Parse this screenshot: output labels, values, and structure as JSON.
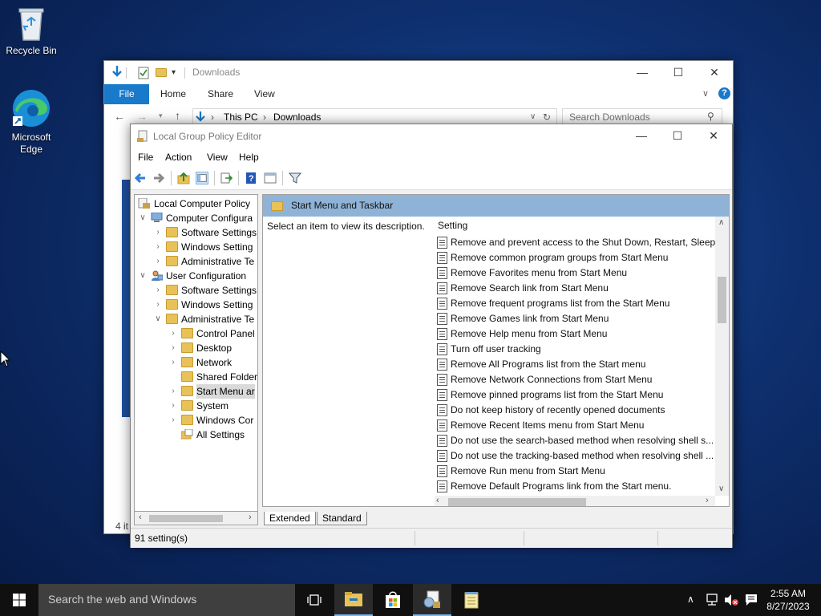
{
  "desktop": {
    "recycle_bin": "Recycle Bin",
    "edge_line1": "Microsoft",
    "edge_line2": "Edge"
  },
  "explorer": {
    "title": "Downloads",
    "ribbon_tabs": [
      "File",
      "Home",
      "Share",
      "View"
    ],
    "address_root": "This PC",
    "address_leaf": "Downloads",
    "search_placeholder": "Search Downloads",
    "status": "4 it"
  },
  "gpedit": {
    "title": "Local Group Policy Editor",
    "menu": [
      "File",
      "Action",
      "View",
      "Help"
    ],
    "tree": [
      {
        "label": "Local Computer Policy",
        "depth": 0,
        "icon": "computer-policy-icon"
      },
      {
        "label": "Computer Configura",
        "depth": 1,
        "icon": "computer-icon",
        "expander": "expanded"
      },
      {
        "label": "Software Settings",
        "depth": 2,
        "icon": "folder-icon",
        "expander": "collapsed"
      },
      {
        "label": "Windows Setting",
        "depth": 2,
        "icon": "folder-icon",
        "expander": "collapsed"
      },
      {
        "label": "Administrative Te",
        "depth": 2,
        "icon": "folder-icon",
        "expander": "collapsed"
      },
      {
        "label": "User Configuration",
        "depth": 1,
        "icon": "user-icon",
        "expander": "expanded"
      },
      {
        "label": "Software Settings",
        "depth": 2,
        "icon": "folder-icon",
        "expander": "collapsed"
      },
      {
        "label": "Windows Setting",
        "depth": 2,
        "icon": "folder-icon",
        "expander": "collapsed"
      },
      {
        "label": "Administrative Te",
        "depth": 2,
        "icon": "folder-icon",
        "expander": "expanded"
      },
      {
        "label": "Control Panel",
        "depth": 3,
        "icon": "folder-icon",
        "expander": "collapsed"
      },
      {
        "label": "Desktop",
        "depth": 3,
        "icon": "folder-icon",
        "expander": "collapsed"
      },
      {
        "label": "Network",
        "depth": 3,
        "icon": "folder-icon",
        "expander": "collapsed"
      },
      {
        "label": "Shared Folder",
        "depth": 3,
        "icon": "folder-icon",
        "expander": "none"
      },
      {
        "label": "Start Menu ar",
        "depth": 3,
        "icon": "folder-icon",
        "expander": "collapsed",
        "selected": true
      },
      {
        "label": "System",
        "depth": 3,
        "icon": "folder-icon",
        "expander": "collapsed"
      },
      {
        "label": "Windows Cor",
        "depth": 3,
        "icon": "folder-icon",
        "expander": "collapsed"
      },
      {
        "label": "All Settings",
        "depth": 3,
        "icon": "all-settings-icon",
        "expander": "none"
      }
    ],
    "pane_title": "Start Menu and Taskbar",
    "description": "Select an item to view its description.",
    "column_header": "Setting",
    "settings": [
      "Remove and prevent access to the Shut Down, Restart, Sleep...",
      "Remove common program groups from Start Menu",
      "Remove Favorites menu from Start Menu",
      "Remove Search link from Start Menu",
      "Remove frequent programs list from the Start Menu",
      "Remove Games link from Start Menu",
      "Remove Help menu from Start Menu",
      "Turn off user tracking",
      "Remove All Programs list from the Start menu",
      "Remove Network Connections from Start Menu",
      "Remove pinned programs list from the Start Menu",
      "Do not keep history of recently opened documents",
      "Remove Recent Items menu from Start Menu",
      "Do not use the search-based method when resolving shell s...",
      "Do not use the tracking-based method when resolving shell ...",
      "Remove Run menu from Start Menu",
      "Remove Default Programs link from the Start menu."
    ],
    "tabs": [
      "Extended",
      "Standard"
    ],
    "status": "91 setting(s)"
  },
  "taskbar": {
    "search_placeholder": "Search the web and Windows",
    "time": "2:55 AM",
    "date": "8/27/2023"
  },
  "colors": {
    "accent_blue": "#1979ca",
    "pane_header": "#8fb3d6",
    "taskbar": "#101010"
  }
}
